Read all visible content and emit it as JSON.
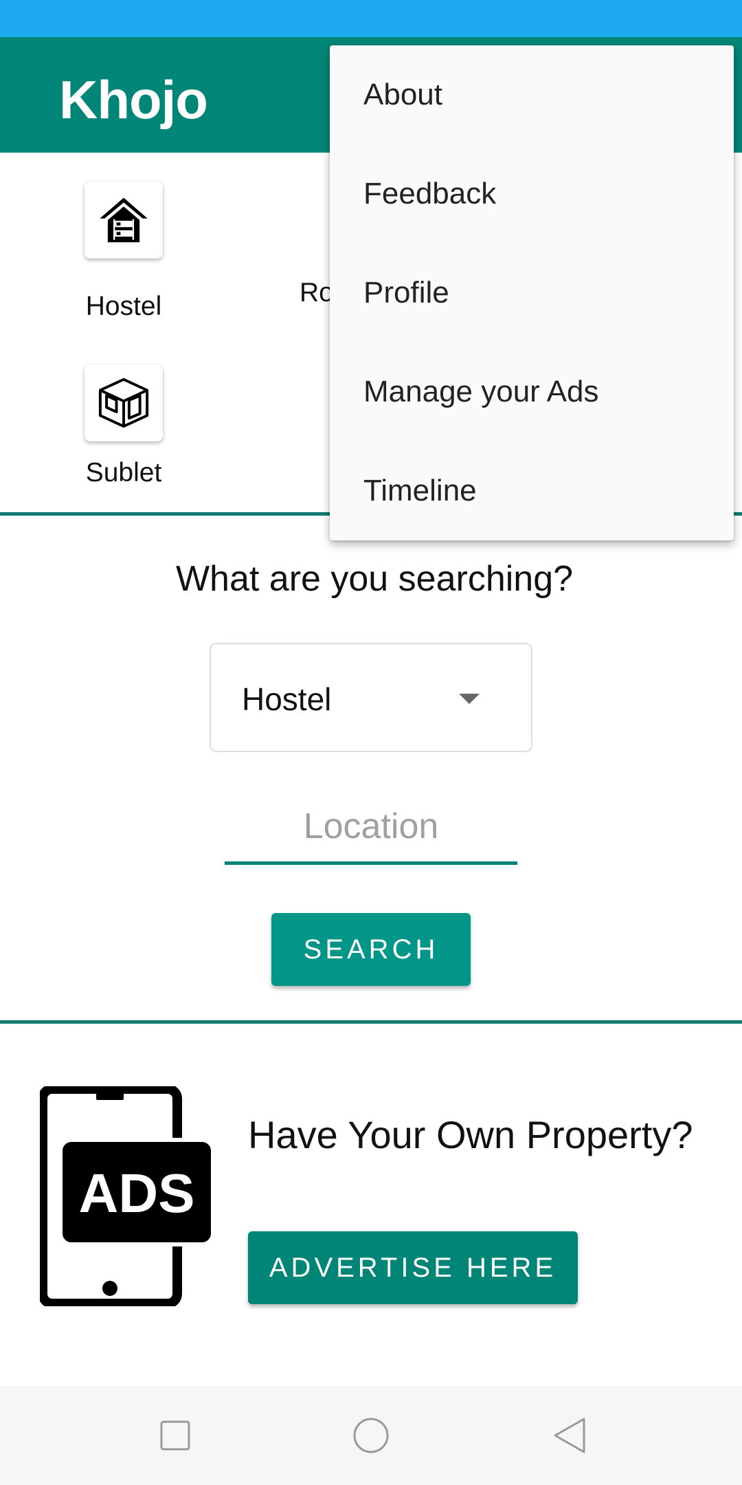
{
  "app": {
    "title": "Khojo"
  },
  "categories": {
    "hostel": {
      "label": "Hostel",
      "icon": "hostel-icon"
    },
    "room": {
      "label": "Ro"
    },
    "sublet": {
      "label": "Sublet",
      "icon": "sublet-room-icon"
    }
  },
  "search": {
    "heading": "What are you searching?",
    "type_selected": "Hostel",
    "location_placeholder": "Location",
    "location_value": "",
    "button_label": "SEARCH"
  },
  "promo": {
    "ads_icon_text": "ADS",
    "heading": "Have Your Own Property?",
    "button_label": "ADVERTISE HERE"
  },
  "overflow_menu": {
    "items": [
      {
        "label": "About"
      },
      {
        "label": "Feedback"
      },
      {
        "label": "Profile"
      },
      {
        "label": "Manage your Ads"
      },
      {
        "label": "Timeline"
      }
    ]
  },
  "nav": {
    "icons": [
      "recents-icon",
      "home-icon",
      "back-icon"
    ]
  },
  "colors": {
    "status_bar": "#1eaaf1",
    "primary": "#008577",
    "search_button": "#029688",
    "menu_background": "#fafafa",
    "nav_bar": "#f6f6f6"
  }
}
